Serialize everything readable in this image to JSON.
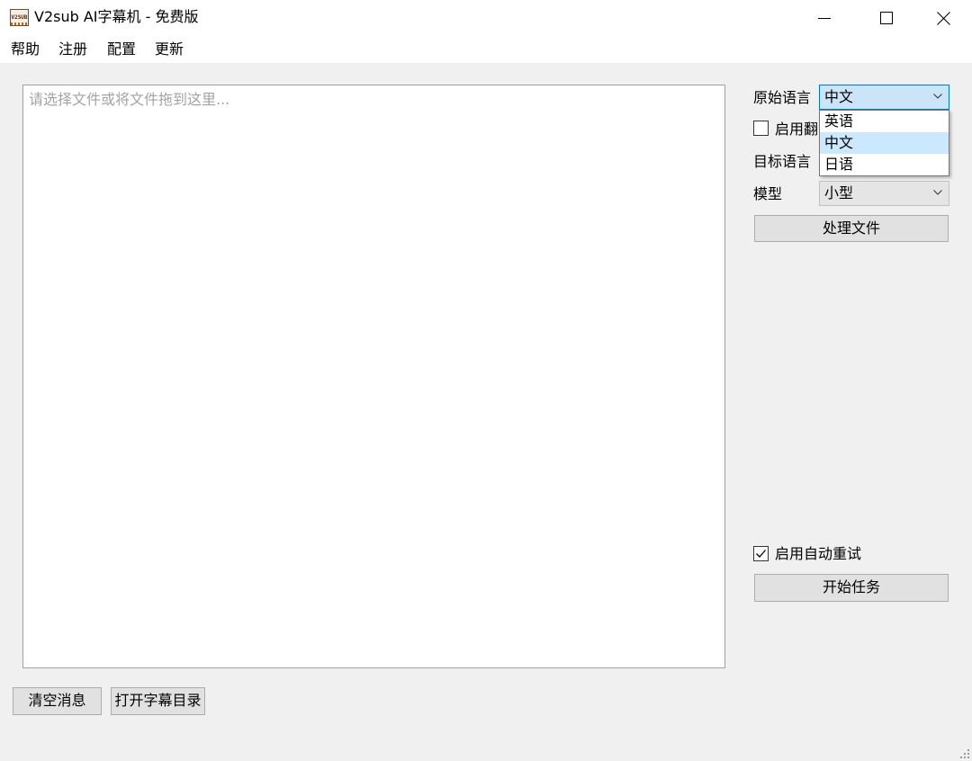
{
  "window": {
    "app_icon_text": "V2SUB",
    "title": "V2sub AI字幕机 - 免费版",
    "controls": [
      "minimize-icon",
      "maximize-icon",
      "close-icon"
    ]
  },
  "menu": {
    "items": [
      "帮助",
      "注册",
      "配置",
      "更新"
    ]
  },
  "main": {
    "drop_area_placeholder": "请选择文件或将文件拖到这里..."
  },
  "settings": {
    "source_language_label": "原始语言",
    "source_language_value": "中文",
    "enable_translation_label": "启用翻译",
    "enable_translation_checked": false,
    "target_language_label": "目标语言",
    "model_label": "模型",
    "model_value": "小型",
    "process_file_button": "处理文件",
    "auto_retry_label": "启用自动重试",
    "auto_retry_checked": true,
    "start_task_button": "开始任务"
  },
  "dropdown": {
    "options": [
      "英语",
      "中文",
      "日语"
    ],
    "selected": "中文"
  },
  "footer": {
    "clear_messages_button": "清空消息",
    "open_subtitle_dir_button": "打开字幕目录"
  },
  "colors": {
    "focus_border": "#0078d7",
    "selection_fill": "#cce8ff",
    "window_bg": "#f0f0f0"
  }
}
